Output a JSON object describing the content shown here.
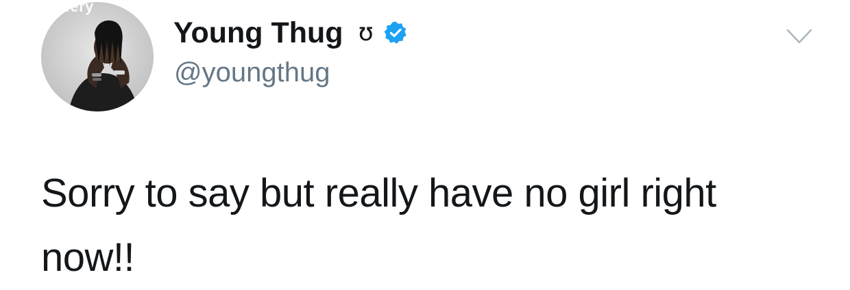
{
  "tweet": {
    "author": {
      "display_name": "Young Thug",
      "name_emoji": "ʊ",
      "handle": "@youngthug",
      "verified": true,
      "avatar_watermark": "effery"
    },
    "text": "Sorry to say but really have no girl right now!!",
    "colors": {
      "verified_badge": "#1da1f2",
      "handle": "#657786",
      "text": "#14171a",
      "caret": "#aab8c2"
    },
    "icons": {
      "verified": "verified-badge-icon",
      "menu": "chevron-down-icon"
    }
  }
}
